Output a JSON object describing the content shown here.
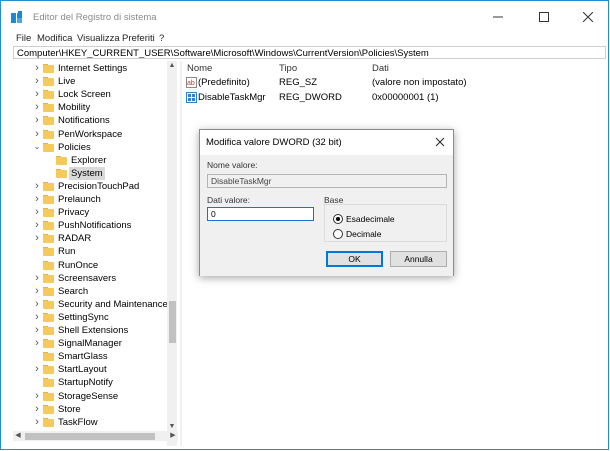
{
  "window": {
    "title": "Editor del Registro di sistema",
    "minimize_glyph": "—",
    "maximize_glyph": "☐",
    "close_glyph": "✕"
  },
  "menu": [
    "File",
    "Modifica",
    "Visualizza",
    "Preferiti",
    "?"
  ],
  "address": "Computer\\HKEY_CURRENT_USER\\Software\\Microsoft\\Windows\\CurrentVersion\\Policies\\System",
  "tree": [
    {
      "label": "Internet Settings",
      "expander": ">",
      "level": 0
    },
    {
      "label": "Live",
      "expander": ">",
      "level": 0
    },
    {
      "label": "Lock Screen",
      "expander": ">",
      "level": 0
    },
    {
      "label": "Mobility",
      "expander": ">",
      "level": 0
    },
    {
      "label": "Notifications",
      "expander": ">",
      "level": 0
    },
    {
      "label": "PenWorkspace",
      "expander": ">",
      "level": 0
    },
    {
      "label": "Policies",
      "expander": "v",
      "level": 0
    },
    {
      "label": "Explorer",
      "expander": "",
      "level": 1
    },
    {
      "label": "System",
      "expander": "",
      "level": 1,
      "selected": true
    },
    {
      "label": "PrecisionTouchPad",
      "expander": ">",
      "level": 0
    },
    {
      "label": "Prelaunch",
      "expander": ">",
      "level": 0
    },
    {
      "label": "Privacy",
      "expander": ">",
      "level": 0
    },
    {
      "label": "PushNotifications",
      "expander": ">",
      "level": 0
    },
    {
      "label": "RADAR",
      "expander": ">",
      "level": 0
    },
    {
      "label": "Run",
      "expander": "",
      "level": 0
    },
    {
      "label": "RunOnce",
      "expander": "",
      "level": 0
    },
    {
      "label": "Screensavers",
      "expander": ">",
      "level": 0
    },
    {
      "label": "Search",
      "expander": ">",
      "level": 0
    },
    {
      "label": "Security and Maintenance",
      "expander": ">",
      "level": 0
    },
    {
      "label": "SettingSync",
      "expander": ">",
      "level": 0
    },
    {
      "label": "Shell Extensions",
      "expander": ">",
      "level": 0
    },
    {
      "label": "SignalManager",
      "expander": ">",
      "level": 0
    },
    {
      "label": "SmartGlass",
      "expander": "",
      "level": 0
    },
    {
      "label": "StartLayout",
      "expander": ">",
      "level": 0
    },
    {
      "label": "StartupNotify",
      "expander": "",
      "level": 0
    },
    {
      "label": "StorageSense",
      "expander": ">",
      "level": 0
    },
    {
      "label": "Store",
      "expander": ">",
      "level": 0
    },
    {
      "label": "TaskFlow",
      "expander": ">",
      "level": 0
    }
  ],
  "list": {
    "columns": [
      "Nome",
      "Tipo",
      "Dati"
    ],
    "rows": [
      {
        "name": "(Predefinito)",
        "type": "REG_SZ",
        "data": "(valore non impostato)",
        "icon": "string-value-icon"
      },
      {
        "name": "DisableTaskMgr",
        "type": "REG_DWORD",
        "data": "0x00000001 (1)",
        "icon": "dword-value-icon"
      }
    ]
  },
  "dialog": {
    "title": "Modifica valore DWORD (32 bit)",
    "name_label": "Nome valore:",
    "name_value": "DisableTaskMgr",
    "data_label": "Dati valore:",
    "data_value": "0",
    "base_label": "Base",
    "options": [
      {
        "label": "Esadecimale",
        "selected": true
      },
      {
        "label": "Decimale",
        "selected": false
      }
    ],
    "ok": "OK",
    "cancel": "Annulla"
  },
  "colors": {
    "accent": "#0078d7",
    "folder": "#f5c95b",
    "selection": "#d9d9d9"
  }
}
